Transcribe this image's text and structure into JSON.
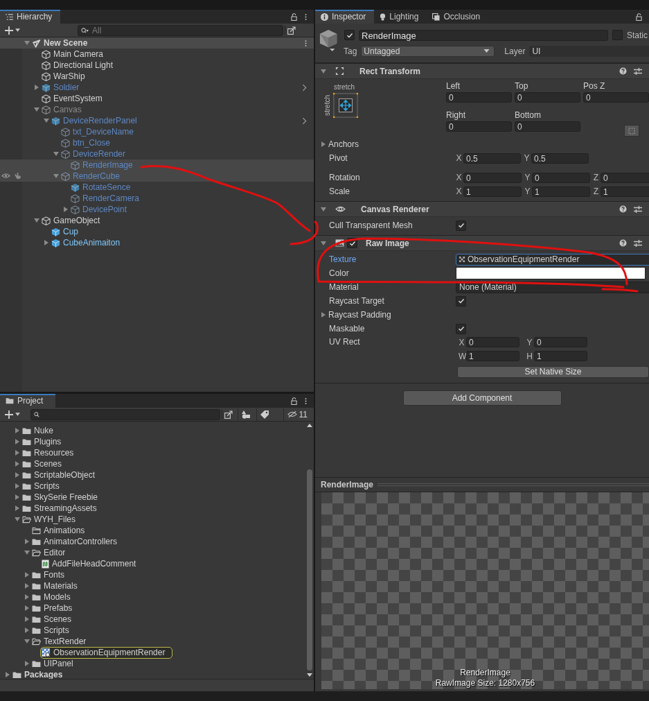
{
  "hierarchy": {
    "tab": "Hierarchy",
    "search_placeholder": "All",
    "scene": {
      "name": "New Scene",
      "expanded": true
    },
    "items": [
      {
        "name": "Main Camera",
        "kind": "object",
        "active": true,
        "highlighted": false
      },
      {
        "name": "Directional Light",
        "kind": "object",
        "active": true,
        "highlighted": false
      },
      {
        "name": "WarShip",
        "kind": "object",
        "active": true,
        "highlighted": false
      },
      {
        "name": "Soldier",
        "kind": "prefab_root",
        "active": false,
        "highlighted": false,
        "expanded": false,
        "chevron": true
      },
      {
        "name": "EventSystem",
        "kind": "object",
        "active": true,
        "highlighted": false
      },
      {
        "name": "Canvas",
        "kind": "object",
        "active": false,
        "highlighted": false,
        "expanded": true,
        "children": [
          {
            "name": "DeviceRenderPanel",
            "kind": "prefab_root",
            "active": false,
            "highlighted": false,
            "expanded": true,
            "chevron": true,
            "children": [
              {
                "name": "txt_DeviceName",
                "kind": "prefab_child",
                "active": false,
                "highlighted": false
              },
              {
                "name": "btn_Close",
                "kind": "prefab_child",
                "active": false,
                "highlighted": false
              },
              {
                "name": "DeviceRender",
                "kind": "prefab_child",
                "active": false,
                "highlighted": false,
                "expanded": true,
                "children": [
                  {
                    "name": "RenderImage",
                    "kind": "prefab_child",
                    "active": false,
                    "highlighted": true
                  }
                ]
              },
              {
                "name": "RenderCube",
                "kind": "prefab_child",
                "active": false,
                "highlighted": true,
                "toggles": true,
                "expanded": true,
                "children": [
                  {
                    "name": "RotateSence",
                    "kind": "prefab_root",
                    "active": false,
                    "highlighted": false
                  },
                  {
                    "name": "RenderCamera",
                    "kind": "prefab_child",
                    "active": false,
                    "highlighted": false
                  },
                  {
                    "name": "DevicePoint",
                    "kind": "prefab_child",
                    "active": false,
                    "highlighted": false,
                    "expanded": false
                  }
                ]
              }
            ]
          }
        ]
      },
      {
        "name": "GameObject",
        "kind": "object",
        "active": true,
        "highlighted": false,
        "expanded": true,
        "children": [
          {
            "name": "Cup",
            "kind": "prefab_root",
            "active": true,
            "highlighted": false
          },
          {
            "name": "CubeAnimaiton",
            "kind": "prefab_root",
            "active": true,
            "highlighted": false,
            "expanded": false
          }
        ]
      }
    ]
  },
  "project": {
    "tab": "Project",
    "hidden_count": "11",
    "assets_items": [
      {
        "name": "Nuke",
        "kind": "folder",
        "expanded": false
      },
      {
        "name": "Plugins",
        "kind": "folder",
        "expanded": false
      },
      {
        "name": "Resources",
        "kind": "folder",
        "expanded": false
      },
      {
        "name": "Scenes",
        "kind": "folder",
        "expanded": false
      },
      {
        "name": "ScriptableObject",
        "kind": "folder",
        "expanded": false
      },
      {
        "name": "Scripts",
        "kind": "folder",
        "expanded": false
      },
      {
        "name": "SkySerie Freebie",
        "kind": "folder",
        "expanded": false
      },
      {
        "name": "StreamingAssets",
        "kind": "folder",
        "expanded": false
      },
      {
        "name": "WYH_Files",
        "kind": "folder",
        "expanded": true,
        "children": [
          {
            "name": "Animations",
            "kind": "empty_folder"
          },
          {
            "name": "AnimatorControllers",
            "kind": "folder",
            "expanded": false
          },
          {
            "name": "Editor",
            "kind": "folder",
            "expanded": true,
            "children": [
              {
                "name": "AddFileHeadComment",
                "kind": "script"
              }
            ]
          },
          {
            "name": "Fonts",
            "kind": "folder",
            "expanded": false
          },
          {
            "name": "Materials",
            "kind": "folder",
            "expanded": false
          },
          {
            "name": "Models",
            "kind": "folder",
            "expanded": false
          },
          {
            "name": "Prefabs",
            "kind": "folder",
            "expanded": false
          },
          {
            "name": "Scenes",
            "kind": "folder",
            "expanded": false
          },
          {
            "name": "Scripts",
            "kind": "folder",
            "expanded": false
          },
          {
            "name": "TextRender",
            "kind": "folder",
            "expanded": true,
            "children": [
              {
                "name": "ObservationEquipmentRender",
                "kind": "render_texture",
                "pinged": true
              }
            ]
          },
          {
            "name": "UIPanel",
            "kind": "folder",
            "expanded": false
          }
        ]
      }
    ],
    "root_items": [
      {
        "name": "Packages",
        "kind": "folder",
        "expanded": false
      }
    ]
  },
  "inspector": {
    "tabs": [
      {
        "label": "Inspector",
        "kind": "info",
        "selected": true
      },
      {
        "label": "Lighting",
        "kind": "bulb",
        "selected": false
      },
      {
        "label": "Occlusion",
        "kind": "occlusion",
        "selected": false
      }
    ],
    "object": {
      "active": true,
      "name": "RenderImage",
      "static_label": "Static",
      "static": false,
      "tag_label": "Tag",
      "tag": "Untagged",
      "layer_label": "Layer",
      "layer": "UI"
    },
    "components": [
      {
        "kind": "rect_transform",
        "title": "Rect Transform",
        "expanded": true,
        "anchor_preset": {
          "horizontal": "stretch",
          "vertical": "stretch"
        },
        "position_fields": [
          {
            "label": "Left",
            "value": "0"
          },
          {
            "label": "Top",
            "value": "0"
          },
          {
            "label": "Pos Z",
            "value": "0"
          },
          {
            "label": "Right",
            "value": "0"
          },
          {
            "label": "Bottom",
            "value": "0"
          }
        ],
        "anchors": {
          "label": "Anchors",
          "expanded": false
        },
        "vector_rows": [
          {
            "label": "Pivot",
            "fields": [
              {
                "axis": "X",
                "value": "0.5"
              },
              {
                "axis": "Y",
                "value": "0.5"
              }
            ]
          },
          {
            "label": "Rotation",
            "fields": [
              {
                "axis": "X",
                "value": "0"
              },
              {
                "axis": "Y",
                "value": "0"
              },
              {
                "axis": "Z",
                "value": "0"
              }
            ]
          },
          {
            "label": "Scale",
            "fields": [
              {
                "axis": "X",
                "value": "1"
              },
              {
                "axis": "Y",
                "value": "1"
              },
              {
                "axis": "Z",
                "value": "1"
              }
            ]
          }
        ]
      },
      {
        "kind": "canvas_renderer",
        "title": "Canvas Renderer",
        "expanded": true,
        "properties": [
          {
            "kind": "checkbox",
            "label": "Cull Transparent Mesh",
            "checked": true
          }
        ]
      },
      {
        "kind": "raw_image",
        "title": "Raw Image",
        "expanded": true,
        "enabled": true,
        "properties": [
          {
            "kind": "object",
            "label": "Texture",
            "value": "ObservationEquipmentRender",
            "focused": true
          },
          {
            "kind": "color",
            "label": "Color",
            "color": "#ffffff"
          },
          {
            "kind": "object",
            "label": "Material",
            "value": "None (Material)",
            "focused": false
          },
          {
            "kind": "checkbox",
            "label": "Raycast Target",
            "checked": true
          },
          {
            "kind": "foldout",
            "label": "Raycast Padding",
            "expanded": false
          },
          {
            "kind": "checkbox",
            "label": "Maskable",
            "checked": true
          },
          {
            "kind": "rect",
            "label": "UV Rect",
            "fields": [
              {
                "axis": "X",
                "value": "0"
              },
              {
                "axis": "Y",
                "value": "0"
              },
              {
                "axis": "W",
                "value": "1"
              },
              {
                "axis": "H",
                "value": "1"
              }
            ]
          },
          {
            "kind": "button",
            "label": "Set Native Size"
          }
        ]
      }
    ],
    "add_component": "Add Component"
  },
  "preview": {
    "title": "RenderImage",
    "overlay_name": "RenderImage",
    "overlay_size": "RawImage Size: 1280x756"
  }
}
